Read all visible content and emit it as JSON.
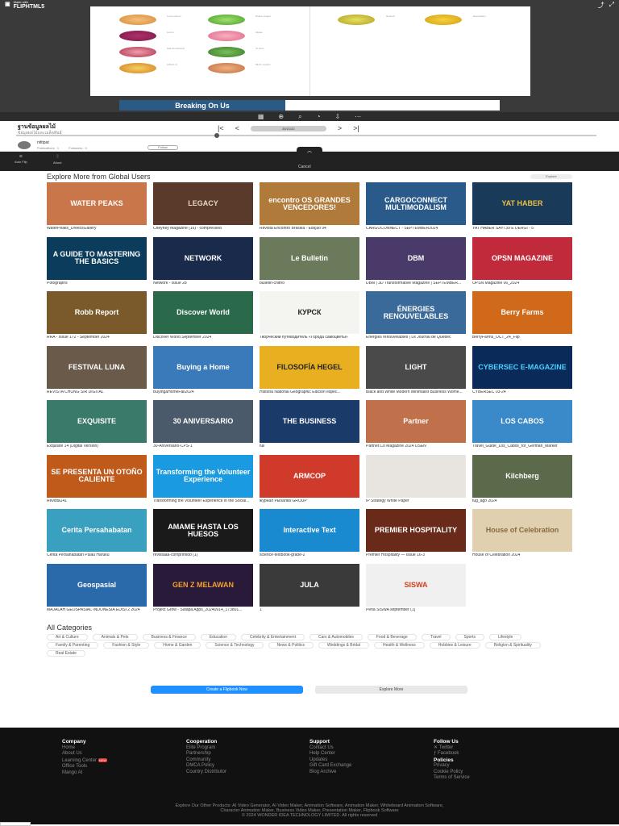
{
  "brand": {
    "made_with": "Made with",
    "name": "FLIPHTML5"
  },
  "book": {
    "left_labels": [
      "Lorem ipsum",
      "Lorem",
      "Sed do eiusmod",
      "Labore et",
      "Dolore magna",
      "Aliqua",
      "Ut enim",
      "Minim veniam"
    ],
    "right_labels": [
      "Nostrud",
      "Exercitation"
    ]
  },
  "ad": {
    "text": "Breaking On Us"
  },
  "nav": {
    "title": "ฐานข้อมูลผลไม้",
    "subtitle": "ข้อมูลผลไม้และเมล็ดพันธุ์",
    "page_indicator": "20/21/22",
    "first": "|<",
    "prev": "<",
    "next": ">",
    "last": ">|"
  },
  "author": {
    "name": "nittipat",
    "publications": "Publications : 1",
    "followers": "Followers : 0",
    "follow": "Follow"
  },
  "actions": {
    "auto_flip": "Auto Flip",
    "about": "About",
    "cancel": "Cancel"
  },
  "explore": {
    "heading": "Explore More from Global Users",
    "button": "Explore",
    "items": [
      {
        "title": "WaterPeaks_DreecsGallery",
        "thumb": "WATER PEAKS",
        "bg": "#c9764a",
        "fg": "#ffffff"
      },
      {
        "title": "Cheyney Magazine (16) - compressed",
        "thumb": "LEGACY",
        "bg": "#5a3a2a",
        "fg": "#e8d9c0"
      },
      {
        "title": "Revista Encontro Brasília - Edição 94",
        "thumb": "encontro OS GRANDES VENCEDORES!",
        "bg": "#b07a3a",
        "fg": "#ffffff"
      },
      {
        "title": "CARGOCONNECT - SEPTEMBER2024",
        "thumb": "CARGOCONNECT MULTIMODALISM",
        "bg": "#2a5a8a",
        "fg": "#ffffff"
      },
      {
        "title": "YAT HABER SAYI 39 E DERGİ - 5",
        "thumb": "YAT HABER",
        "bg": "#1a3a5a",
        "fg": "#f0c040"
      },
      {
        "title": "Potographs",
        "thumb": "A GUIDE TO MASTERING THE BASICS",
        "bg": "#0c3c5c",
        "fg": "#ffffff"
      },
      {
        "title": "Network - Issue 28",
        "thumb": "NETWORK",
        "bg": "#1a2a4a",
        "fg": "#ffffff"
      },
      {
        "title": "bulletin-cnitho",
        "thumb": "Le Bulletin",
        "bg": "#6a7a5a",
        "fg": "#ffffff"
      },
      {
        "title": "DBM | 3D Transformative Magazine | SEPTEMBER...",
        "thumb": "DBM",
        "bg": "#4a3a6a",
        "fg": "#ffffff"
      },
      {
        "title": "OPSN Magazine 06_2024",
        "thumb": "OPSN MAGAZINE",
        "bg": "#c02a3a",
        "fg": "#ffffff"
      },
      {
        "title": "RRA - Issue 172 - September 2024",
        "thumb": "Robb Report",
        "bg": "#7a5a2a",
        "fg": "#ffffff"
      },
      {
        "title": "Discover World September 2024",
        "thumb": "Discover World",
        "bg": "#2a6a4a",
        "fg": "#ffffff"
      },
      {
        "title": "Творческий путеводитель «Города самоцветы»",
        "thumb": "КУРСК",
        "bg": "#f4f4f0",
        "fg": "#222222"
      },
      {
        "title": "Énergies renouvelables | Le Journal de Québec",
        "thumb": "ÉNERGIES RENOUVELABLES",
        "bg": "#3a6a9a",
        "fg": "#ffffff"
      },
      {
        "title": "BerryFarms_OCT_24_Flip",
        "thumb": "Berry Farms",
        "bg": "#d06a1a",
        "fg": "#ffffff"
      },
      {
        "title": "REVISTA CHUNG SIR DIGITAL",
        "thumb": "FESTIVAL LUNA",
        "bg": "#6a5a4a",
        "fg": "#ffffff"
      },
      {
        "title": "BuyingaHomeFall2024",
        "thumb": "Buying a Home",
        "bg": "#3a7aba",
        "fg": "#ffffff"
      },
      {
        "title": "Historia National Geographic Edición espec...",
        "thumb": "FILOSOFÍA HEGEL",
        "bg": "#e8b020",
        "fg": "#222222"
      },
      {
        "title": "Black and White Modern Minimalist Business Wome...",
        "thumb": "LIGHT",
        "bg": "#4a4a4a",
        "fg": "#ffffff"
      },
      {
        "title": "CYBERSEC 03-24",
        "thumb": "CYBERSEC E-MAGAZINE",
        "bg": "#0a2a5a",
        "fg": "#4ad0ff"
      },
      {
        "title": "Exquisite 14 (Digital Version)",
        "thumb": "EXQUISITE",
        "bg": "#3a7a6a",
        "fg": "#ffffff"
      },
      {
        "title": "30-Aniversario-CPS-1",
        "thumb": "30 ANIVERSARIO",
        "bg": "#4a5a6a",
        "fg": "#ffffff"
      },
      {
        "title": "full",
        "thumb": "THE BUSINESS",
        "bg": "#1a3a6a",
        "fg": "#ffffff"
      },
      {
        "title": "Partner.Co Magazine 2024 USEN",
        "thumb": "Partner",
        "bg": "#c0704a",
        "fg": "#ffffff"
      },
      {
        "title": "Travel_Guide_Los_Cabos_for_German_Market",
        "thumb": "LOS CABOS",
        "bg": "#3a8aca",
        "fg": "#ffffff"
      },
      {
        "title": "Revista141",
        "thumb": "SE PRESENTA UN OTOÑO CALIENTE",
        "bg": "#c05a1a",
        "fg": "#ffffff"
      },
      {
        "title": "Transforming the Volunteer Experience in the Social...",
        "thumb": "Transforming the Volunteer Experience",
        "bg": "#1a9ae0",
        "fg": "#ffffff"
      },
      {
        "title": "журнал Рыбалка GROUP",
        "thumb": "ARMCOP",
        "bg": "#d03a2a",
        "fg": "#ffffff"
      },
      {
        "title": "IP Strategy White Paper",
        "thumb": "",
        "bg": "#e8e4e0",
        "fg": "#222222"
      },
      {
        "title": "tug_ago 2024",
        "thumb": "Kilchberg",
        "bg": "#5a6a4a",
        "fg": "#ffffff"
      },
      {
        "title": "Cerita Persahabatan Pulau Haruku",
        "thumb": "Cerita Persahabatan",
        "bg": "#3aa0c0",
        "fg": "#ffffff"
      },
      {
        "title": "revistaaa-comprimido (1)",
        "thumb": "AMAME HASTA LOS HUESOS",
        "bg": "#1a1a1a",
        "fg": "#ffffff"
      },
      {
        "title": "science-textbook-grade-2",
        "thumb": "Interactive Text",
        "bg": "#1a8ad0",
        "fg": "#ffffff"
      },
      {
        "title": "Premier Hospitality — Issue 16-3",
        "thumb": "PREMIER HOSPITALITY",
        "bg": "#6a2a1a",
        "fg": "#ffffff"
      },
      {
        "title": "House of Celebration 2024",
        "thumb": "House of Celebration",
        "bg": "#e0d0b0",
        "fg": "#8a6a3a"
      },
      {
        "title": "MAJALAH GEOSPASIAL INDONESIA EDISI 2 2024",
        "thumb": "Geospasial",
        "bg": "#2a6aaa",
        "fg": "#ffffff"
      },
      {
        "title": "Project Grow - Sutapa Apps_20240914_173801...",
        "thumb": "GEN Z MELAWAN",
        "bg": "#2a1a3a",
        "fg": "#f0a030"
      },
      {
        "title": "1",
        "thumb": "JULA",
        "bg": "#3a3a3a",
        "fg": "#ffffff"
      },
      {
        "title": "Pena SISWA september (1)",
        "thumb": "SISWA",
        "bg": "#f0f0f0",
        "fg": "#d04020"
      }
    ]
  },
  "categories": {
    "heading": "All Categories",
    "items": [
      "Art & Culture",
      "Animals & Pets",
      "Business & Finance",
      "Education",
      "Celebrity & Entertainment",
      "Cars & Automobiles",
      "Food & Beverage",
      "Travel",
      "Sports",
      "Lifestyle",
      "Family & Parenting",
      "Fashion & Style",
      "Home & Garden",
      "Science & Technology",
      "News & Politics",
      "Weddings & Bridal",
      "Health & Wellness",
      "Hobbies & Leisure",
      "Religion & Spirituality",
      "Real Estate"
    ]
  },
  "cta": {
    "create": "Create a Flipbook Now",
    "more": "Explore More"
  },
  "footer": {
    "company": {
      "heading": "Company",
      "links": [
        "Home",
        "About Us",
        "Learning Center",
        "Office Tools",
        "Mango AI"
      ]
    },
    "cooperation": {
      "heading": "Cooperation",
      "links": [
        "Elite Program",
        "Partnership",
        "Community",
        "DMCA Policy",
        "Country Distributor"
      ]
    },
    "support": {
      "heading": "Support",
      "links": [
        "Contact Us",
        "Help Center",
        "Updates",
        "Gift Card Exchange",
        "Blog Archive"
      ]
    },
    "follow": {
      "heading": "Follow Us",
      "links": [
        "Twitter",
        "Facebook"
      ]
    },
    "policies": {
      "heading": "Policies",
      "links": [
        "Privacy",
        "Cookie Policy",
        "Terms of Service"
      ]
    },
    "products_line1": "Explore Our Other Products: AI Video Generator, AI Video Maker, Animation Software, Animation Maker, Whiteboard Animation Software,",
    "products_line2": "Character Animation Maker, Business Video Maker, Presentation Maker, Flipbook Software",
    "copyright": "© 2024 WONDER IDEA TECHNOLOGY LIMITED. All rights reserved",
    "new_badge": "NEW"
  }
}
